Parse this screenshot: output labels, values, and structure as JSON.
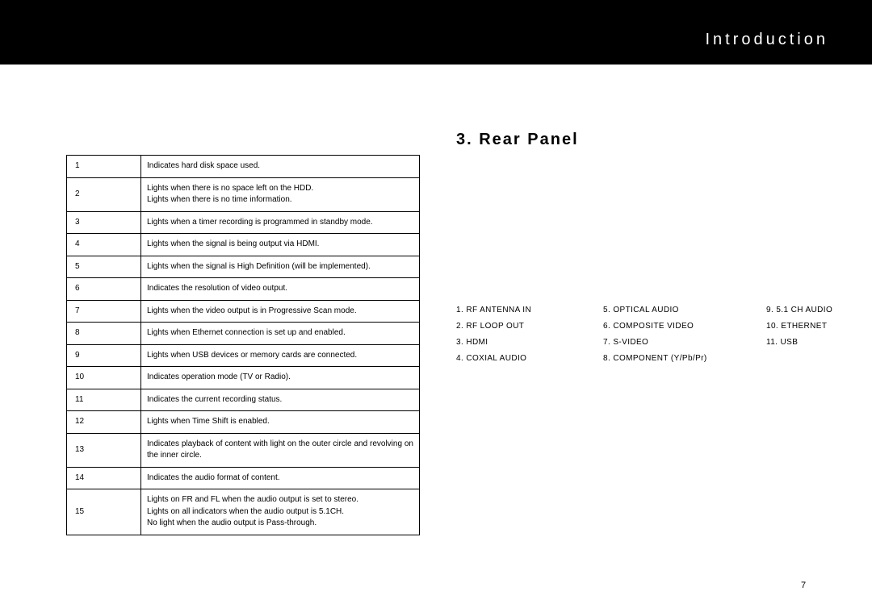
{
  "chapter": "Introduction",
  "section_heading": "3. Rear Panel",
  "page_number": "7",
  "table_rows": [
    {
      "num": "1",
      "lines": [
        "Indicates hard disk space used."
      ]
    },
    {
      "num": "2",
      "lines": [
        "Lights when there is no space left on the HDD.",
        "Lights when there is no time information."
      ]
    },
    {
      "num": "3",
      "lines": [
        "Lights when a timer recording is programmed in standby mode."
      ]
    },
    {
      "num": "4",
      "lines": [
        "Lights when the signal is being output via HDMI."
      ]
    },
    {
      "num": "5",
      "lines": [
        "Lights when the signal is High Definition (will be implemented)."
      ]
    },
    {
      "num": "6",
      "lines": [
        "Indicates the resolution of video output."
      ]
    },
    {
      "num": "7",
      "lines": [
        "Lights when the video output is in Progressive Scan mode."
      ]
    },
    {
      "num": "8",
      "lines": [
        "Lights when Ethernet connection is set up and enabled."
      ]
    },
    {
      "num": "9",
      "lines": [
        "Lights when USB devices or memory cards are connected."
      ]
    },
    {
      "num": "10",
      "lines": [
        "Indicates operation mode (TV or Radio)."
      ]
    },
    {
      "num": "11",
      "lines": [
        "Indicates the current recording status."
      ]
    },
    {
      "num": "12",
      "lines": [
        "Lights when Time Shift is enabled."
      ]
    },
    {
      "num": "13",
      "lines": [
        "Indicates playback of content with light on the outer circle and revolving on the inner circle."
      ],
      "justify": true
    },
    {
      "num": "14",
      "lines": [
        "Indicates the audio format of content."
      ]
    },
    {
      "num": "15",
      "lines": [
        "Lights on FR and FL when the audio output is set to stereo.",
        "Lights on all indicators when the audio output is 5.1CH.",
        "No light when the audio output is Pass-through."
      ]
    }
  ],
  "ports": {
    "col1": [
      "1. RF ANTENNA IN",
      "2. RF LOOP OUT",
      "3. HDMI",
      "4. COXIAL AUDIO"
    ],
    "col2": [
      "5. OPTICAL AUDIO",
      "6. COMPOSITE VIDEO",
      "7. S-VIDEO",
      "8. COMPONENT (Y/Pb/Pr)"
    ],
    "col3": [
      "9. 5.1 CH AUDIO",
      "10. ETHERNET",
      "11. USB"
    ]
  }
}
